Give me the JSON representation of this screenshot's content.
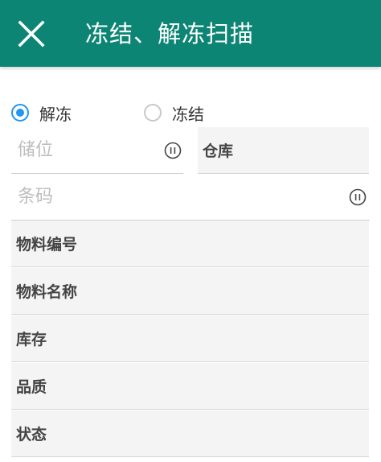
{
  "appbar": {
    "title": "冻结、解冻扫描",
    "background": "#0d8574",
    "close_icon": "close-icon"
  },
  "mode": {
    "options": [
      {
        "label": "解冻",
        "checked": true
      },
      {
        "label": "冻结",
        "checked": false
      }
    ],
    "accent": "#2196f3"
  },
  "location": {
    "placeholder": "储位",
    "value": "",
    "icon": "pause-circle-icon"
  },
  "warehouse": {
    "label": "仓库"
  },
  "barcode": {
    "placeholder": "条码",
    "value": "",
    "icon": "pause-circle-icon"
  },
  "fields": [
    {
      "label": "物料编号"
    },
    {
      "label": "物料名称"
    },
    {
      "label": "库存"
    },
    {
      "label": "品质"
    },
    {
      "label": "状态"
    }
  ]
}
